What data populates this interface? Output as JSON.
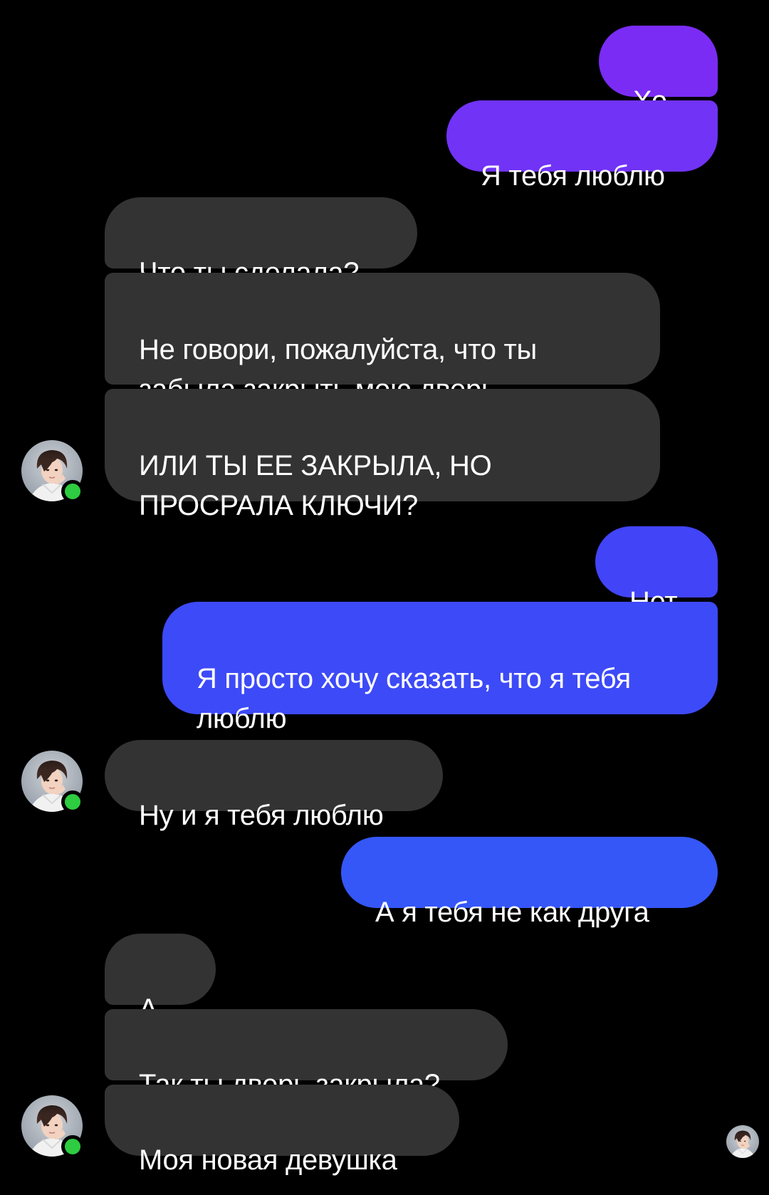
{
  "colors": {
    "background": "#000000",
    "incoming_bubble": "#333333",
    "outgoing_purple": "#7a2cf5",
    "outgoing_blue": "#3b4df8",
    "online_dot": "#2ecc40",
    "text": "#ffffff"
  },
  "contact": {
    "avatar_icon": "profile-photo-icon",
    "status": "online"
  },
  "messages": [
    {
      "sender": "me",
      "text": "Хо.."
    },
    {
      "sender": "me",
      "text": "Я тебя люблю"
    },
    {
      "sender": "them",
      "text": "Что ты сделала?"
    },
    {
      "sender": "them",
      "text": "Не говори, пожалуйста, что ты\nзабыла закрыть мою дверь"
    },
    {
      "sender": "them",
      "text": "ИЛИ ТЫ ЕЕ ЗАКРЫЛА, НО\nПРОСРАЛА КЛЮЧИ?"
    },
    {
      "sender": "me",
      "text": "Нет"
    },
    {
      "sender": "me",
      "text": "Я просто хочу сказать, что я тебя\nлюблю"
    },
    {
      "sender": "them",
      "text": "Ну и я тебя люблю"
    },
    {
      "sender": "me",
      "text": "А я тебя не как друга"
    },
    {
      "sender": "them",
      "text": "А..."
    },
    {
      "sender": "them",
      "text": "Так ты дверь закрыла?"
    },
    {
      "sender": "them",
      "text": "Моя новая девушка"
    }
  ],
  "read_receipt": {
    "icon": "seen-avatar-icon"
  }
}
